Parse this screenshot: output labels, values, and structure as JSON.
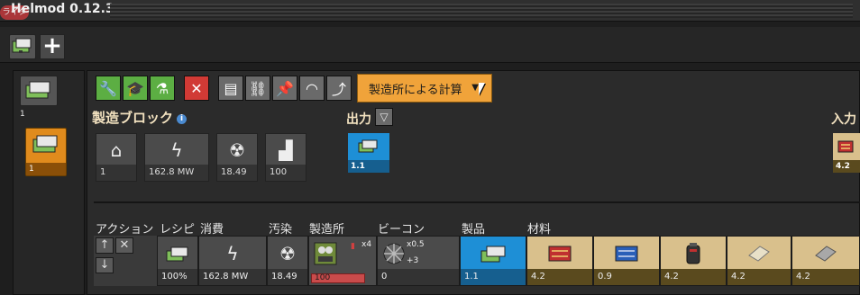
{
  "window": {
    "title": "Helmod 0.12.3",
    "badge": "ライタ"
  },
  "left": {
    "block_count": "1",
    "selected_count": "1"
  },
  "toolbar": {
    "mode_label": "製造所による計算"
  },
  "block": {
    "heading": "製造ブロック",
    "info": "i",
    "summary": [
      {
        "icon": "factory-home-icon",
        "value": "1"
      },
      {
        "icon": "lightning-icon",
        "value": "162.8 MW"
      },
      {
        "icon": "pollution-icon",
        "value": "18.49"
      },
      {
        "icon": "building-icon",
        "value": "100"
      }
    ]
  },
  "output": {
    "heading": "出力",
    "value": "1.1"
  },
  "input": {
    "heading": "入力",
    "value": "4.2"
  },
  "table": {
    "headers": [
      "アクション",
      "レシピ",
      "消費",
      "汚染",
      "製造所",
      "ビーコン",
      "製品",
      "材料"
    ],
    "row": {
      "recipe_pct": "100%",
      "power": "162.8 MW",
      "pollution": "18.49",
      "factory_count": "x4",
      "factory_progress": "100",
      "beacon_speed": "x0.5",
      "beacon_bonus": "+3",
      "beacon_value": "0",
      "product": "1.1",
      "materials": [
        "4.2",
        "0.9",
        "4.2",
        "4.2",
        "4.2"
      ]
    }
  },
  "colors": {
    "accent": "#f0a33a",
    "product": "#1e8fd6",
    "material": "#d9c08c",
    "green": "#5cae43",
    "red": "#d13a35"
  }
}
